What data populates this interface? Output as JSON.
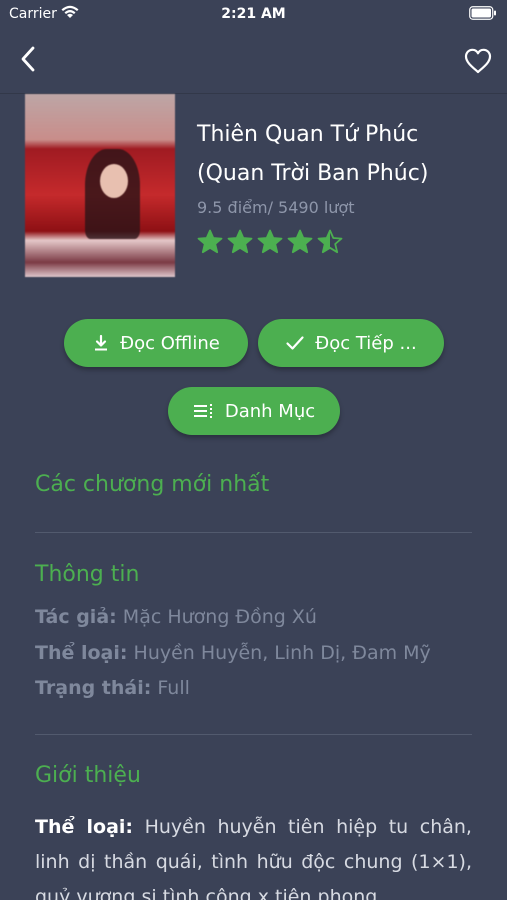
{
  "status_bar": {
    "carrier": "Carrier",
    "time": "2:21 AM"
  },
  "nav": {
    "back_icon": "chevron-left-icon",
    "favorite_icon": "heart-outline-icon"
  },
  "book": {
    "title": "Thiên Quan Tứ Phúc (Quan Trời Ban Phúc)",
    "score": "9.5 điểm/ 5490 lượt",
    "rating": 4.5,
    "rating_max": 5
  },
  "actions": {
    "offline_label": "Đọc Offline",
    "continue_label": "Đọc Tiếp ...",
    "toc_label": "Danh Mục"
  },
  "sections": {
    "latest": "Các chương mới nhất",
    "info": "Thông tin",
    "intro": "Giới thiệu"
  },
  "info": {
    "author_label": "Tác giả:",
    "author_value": "Mặc Hương Đồng Xú",
    "genre_label": "Thể loại:",
    "genre_value": "Huyền Huyễn, Linh Dị, Đam Mỹ",
    "status_label": "Trạng thái:",
    "status_value": "Full"
  },
  "intro": {
    "label": "Thể loại:",
    "text": "Huyền huyễn tiên hiệp tu chân, linh dị thần quái, tình hữu độc chung (1×1), quỷ vương si tình công x tiên phong"
  },
  "colors": {
    "background": "#3b4257",
    "accent": "#4caf50",
    "muted": "#7f889c"
  }
}
